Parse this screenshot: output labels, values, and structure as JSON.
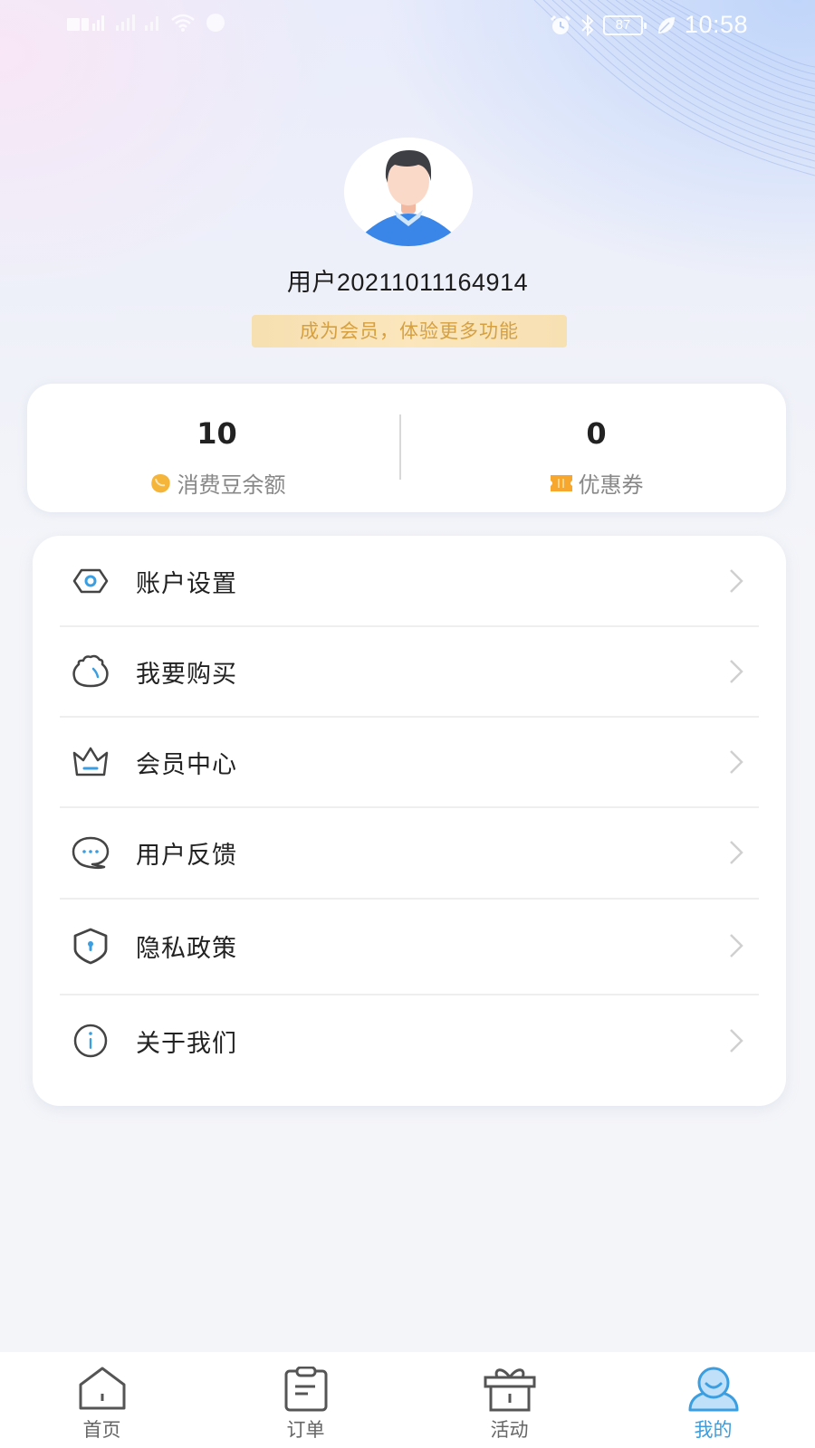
{
  "status_bar": {
    "time": "10:58",
    "battery_percent": "87",
    "icons_left": [
      "signal-icon",
      "signal-icon",
      "wifi-icon",
      "message-icon"
    ],
    "icons_right": [
      "alarm-icon",
      "bluetooth-icon",
      "battery-icon",
      "leaf-icon"
    ]
  },
  "profile": {
    "username": "用户20211011164914",
    "member_prompt": "成为会员，体验更多功能"
  },
  "stats": [
    {
      "value": "10",
      "label": "消费豆余额",
      "icon": "bean-icon"
    },
    {
      "value": "0",
      "label": "优惠券",
      "icon": "coupon-icon"
    }
  ],
  "menu": {
    "items": [
      {
        "label": "账户设置",
        "icon": "account-settings-icon"
      },
      {
        "label": "我要购买",
        "icon": "purchase-bag-icon"
      },
      {
        "label": "会员中心",
        "icon": "crown-icon"
      },
      {
        "label": "用户反馈",
        "icon": "chat-bubble-icon"
      },
      {
        "label": "隐私政策",
        "icon": "shield-icon"
      },
      {
        "label": "关于我们",
        "icon": "info-icon"
      }
    ]
  },
  "tabbar": {
    "active": "我的",
    "tabs": [
      {
        "label": "首页",
        "icon": "home-icon"
      },
      {
        "label": "订单",
        "icon": "clipboard-icon"
      },
      {
        "label": "活动",
        "icon": "gift-icon"
      },
      {
        "label": "我的",
        "icon": "user-icon"
      }
    ]
  },
  "colors": {
    "accent": "#3a9ee0",
    "member_text": "#d6a040",
    "member_bg": "#f8e1b4",
    "bean": "#f5b43a",
    "icon_stroke": "#444444",
    "icon_accent": "#3a9ee0"
  }
}
